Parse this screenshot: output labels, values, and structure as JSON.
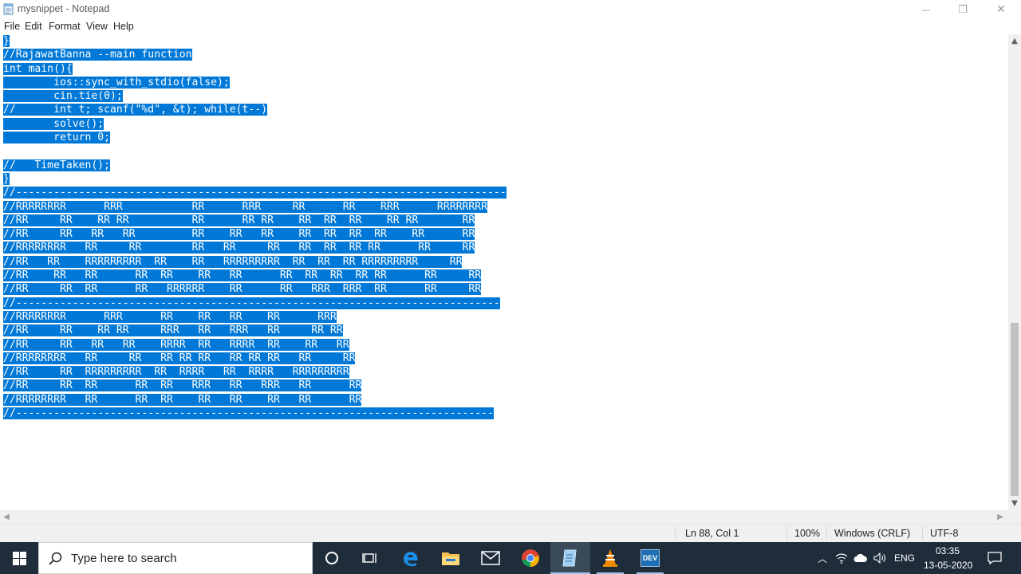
{
  "window": {
    "title": "mysnippet - Notepad",
    "minimize_glyph": "—",
    "restore_glyph": "❐",
    "close_glyph": "✕"
  },
  "menu": [
    "File",
    "Edit",
    "Format",
    "View",
    "Help"
  ],
  "editor": {
    "lines": [
      {
        "text": "}",
        "selected": true
      },
      {
        "text": "//RajawatBanna --main function",
        "selected": true
      },
      {
        "text": "int main(){",
        "selected": true
      },
      {
        "text": "        ios::sync_with_stdio(false);",
        "selected": true
      },
      {
        "text": "        cin.tie(0);",
        "selected": true
      },
      {
        "text": "//      int t; scanf(\"%d\", &t); while(t--)",
        "selected": true
      },
      {
        "text": "        solve();",
        "selected": true
      },
      {
        "text": "        return 0;",
        "selected": true
      },
      {
        "text": "",
        "selected": false
      },
      {
        "text": "//   TimeTaken();",
        "selected": true
      },
      {
        "text": "}",
        "selected": true
      },
      {
        "text": "//------------------------------------------------------------------------------",
        "selected": true
      },
      {
        "text": "//RRRRRRRR      RRR           RR      RRR     RR      RR    RRR      RRRRRRRR",
        "selected": true
      },
      {
        "text": "//RR     RR    RR RR          RR      RR RR    RR  RR  RR    RR RR       RR",
        "selected": true
      },
      {
        "text": "//RR     RR   RR   RR         RR    RR   RR    RR  RR  RR  RR    RR      RR",
        "selected": true
      },
      {
        "text": "//RRRRRRRR   RR     RR        RR   RR     RR   RR  RR  RR RR      RR     RR",
        "selected": true
      },
      {
        "text": "//RR   RR    RRRRRRRRR  RR    RR   RRRRRRRRR  RR  RR  RR RRRRRRRRR     RR",
        "selected": true
      },
      {
        "text": "//RR    RR   RR      RR  RR    RR   RR      RR  RR  RR  RR RR      RR     RR",
        "selected": true
      },
      {
        "text": "//RR     RR  RR      RR   RRRRRR    RR      RR   RRR  RRR  RR      RR     RR",
        "selected": true
      },
      {
        "text": "//-----------------------------------------------------------------------------",
        "selected": true
      },
      {
        "text": "//RRRRRRRR      RRR      RR    RR   RR    RR      RRR",
        "selected": true
      },
      {
        "text": "//RR     RR    RR RR     RRR   RR   RRR   RR     RR RR",
        "selected": true
      },
      {
        "text": "//RR     RR   RR   RR    RRRR  RR   RRRR  RR    RR   RR",
        "selected": true
      },
      {
        "text": "//RRRRRRRR   RR     RR   RR RR RR   RR RR RR   RR     RR",
        "selected": true
      },
      {
        "text": "//RR     RR  RRRRRRRRR  RR  RRRR   RR  RRRR   RRRRRRRRR",
        "selected": true
      },
      {
        "text": "//RR     RR  RR      RR  RR   RRR   RR   RRR   RR      RR",
        "selected": true
      },
      {
        "text": "//RRRRRRRR   RR      RR  RR    RR   RR    RR   RR      RR",
        "selected": true
      },
      {
        "text": "//----------------------------------------------------------------------------",
        "selected": true
      }
    ]
  },
  "statusbar": {
    "position": "Ln 88, Col 1",
    "zoom": "100%",
    "line_ending": "Windows (CRLF)",
    "encoding": "UTF-8"
  },
  "taskbar": {
    "search_placeholder": "Type here to search",
    "language": "ENG",
    "time": "03:35",
    "date": "13-05-2020",
    "devcpp_label": "DEV"
  },
  "colors": {
    "selection": "#0078d7",
    "taskbar": "#1f2d3b"
  }
}
